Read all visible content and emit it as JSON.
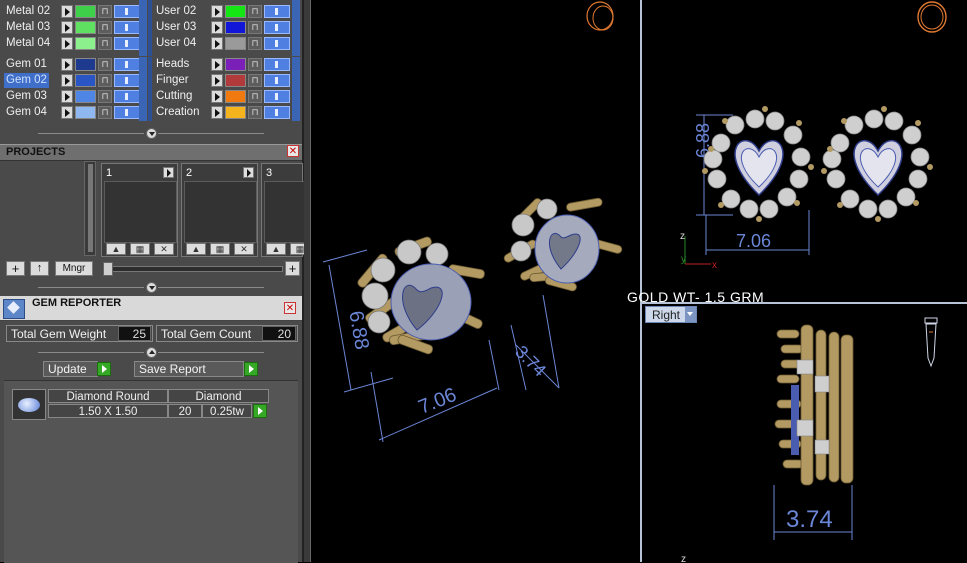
{
  "layers": {
    "left": [
      {
        "label": "Metal 02",
        "color": "#3fd04a"
      },
      {
        "label": "Metal 03",
        "color": "#5fe060"
      },
      {
        "label": "Metal 04",
        "color": "#8cf08c"
      },
      {
        "label": "Gem 01",
        "color": "#1e3a8f"
      },
      {
        "label": "Gem 02",
        "color": "#2a55c5",
        "selected": true
      },
      {
        "label": "Gem 03",
        "color": "#4f86e6"
      },
      {
        "label": "Gem 04",
        "color": "#8fb8f0"
      }
    ],
    "right": [
      {
        "label": "User 02",
        "color": "#14e614"
      },
      {
        "label": "User 03",
        "color": "#1216d8"
      },
      {
        "label": "User 04",
        "color": "#9a9a9a"
      },
      {
        "label": "Heads",
        "color": "#7a1fb8"
      },
      {
        "label": "Finger",
        "color": "#b23a3a"
      },
      {
        "label": "Cutting",
        "color": "#f07a10"
      },
      {
        "label": "Creation",
        "color": "#f5b41e"
      }
    ]
  },
  "projects": {
    "title": "PROJECTS",
    "cards": [
      {
        "num": "1"
      },
      {
        "num": "2"
      },
      {
        "num": "3"
      }
    ],
    "toolbar": {
      "add": "+",
      "up": "↑",
      "manager": "Mngr",
      "zoom_in": "+"
    }
  },
  "gem_reporter": {
    "title": "GEM REPORTER",
    "total_weight_label": "Total Gem Weight",
    "total_weight": "25",
    "total_count_label": "Total Gem Count",
    "total_count": "20",
    "update_label": "Update",
    "save_label": "Save Report",
    "gems": [
      {
        "name": "Diamond Round",
        "material": "Diamond",
        "size": "1.50 X 1.50",
        "count": "20",
        "weight": "0.25tw"
      }
    ]
  },
  "viewports": {
    "gold_weight": "GOLD WT- 1.5 GRM",
    "right_view_label": "Right",
    "dim_height": "6.88",
    "dim_width": "7.06",
    "dim_depth": "3.74",
    "axis_z": "z",
    "axis_y": "y",
    "axis_x": "x"
  },
  "colors": {
    "gold": "#b39a62",
    "dimension": "#6b86d6",
    "heart": "#d8d8e0"
  }
}
